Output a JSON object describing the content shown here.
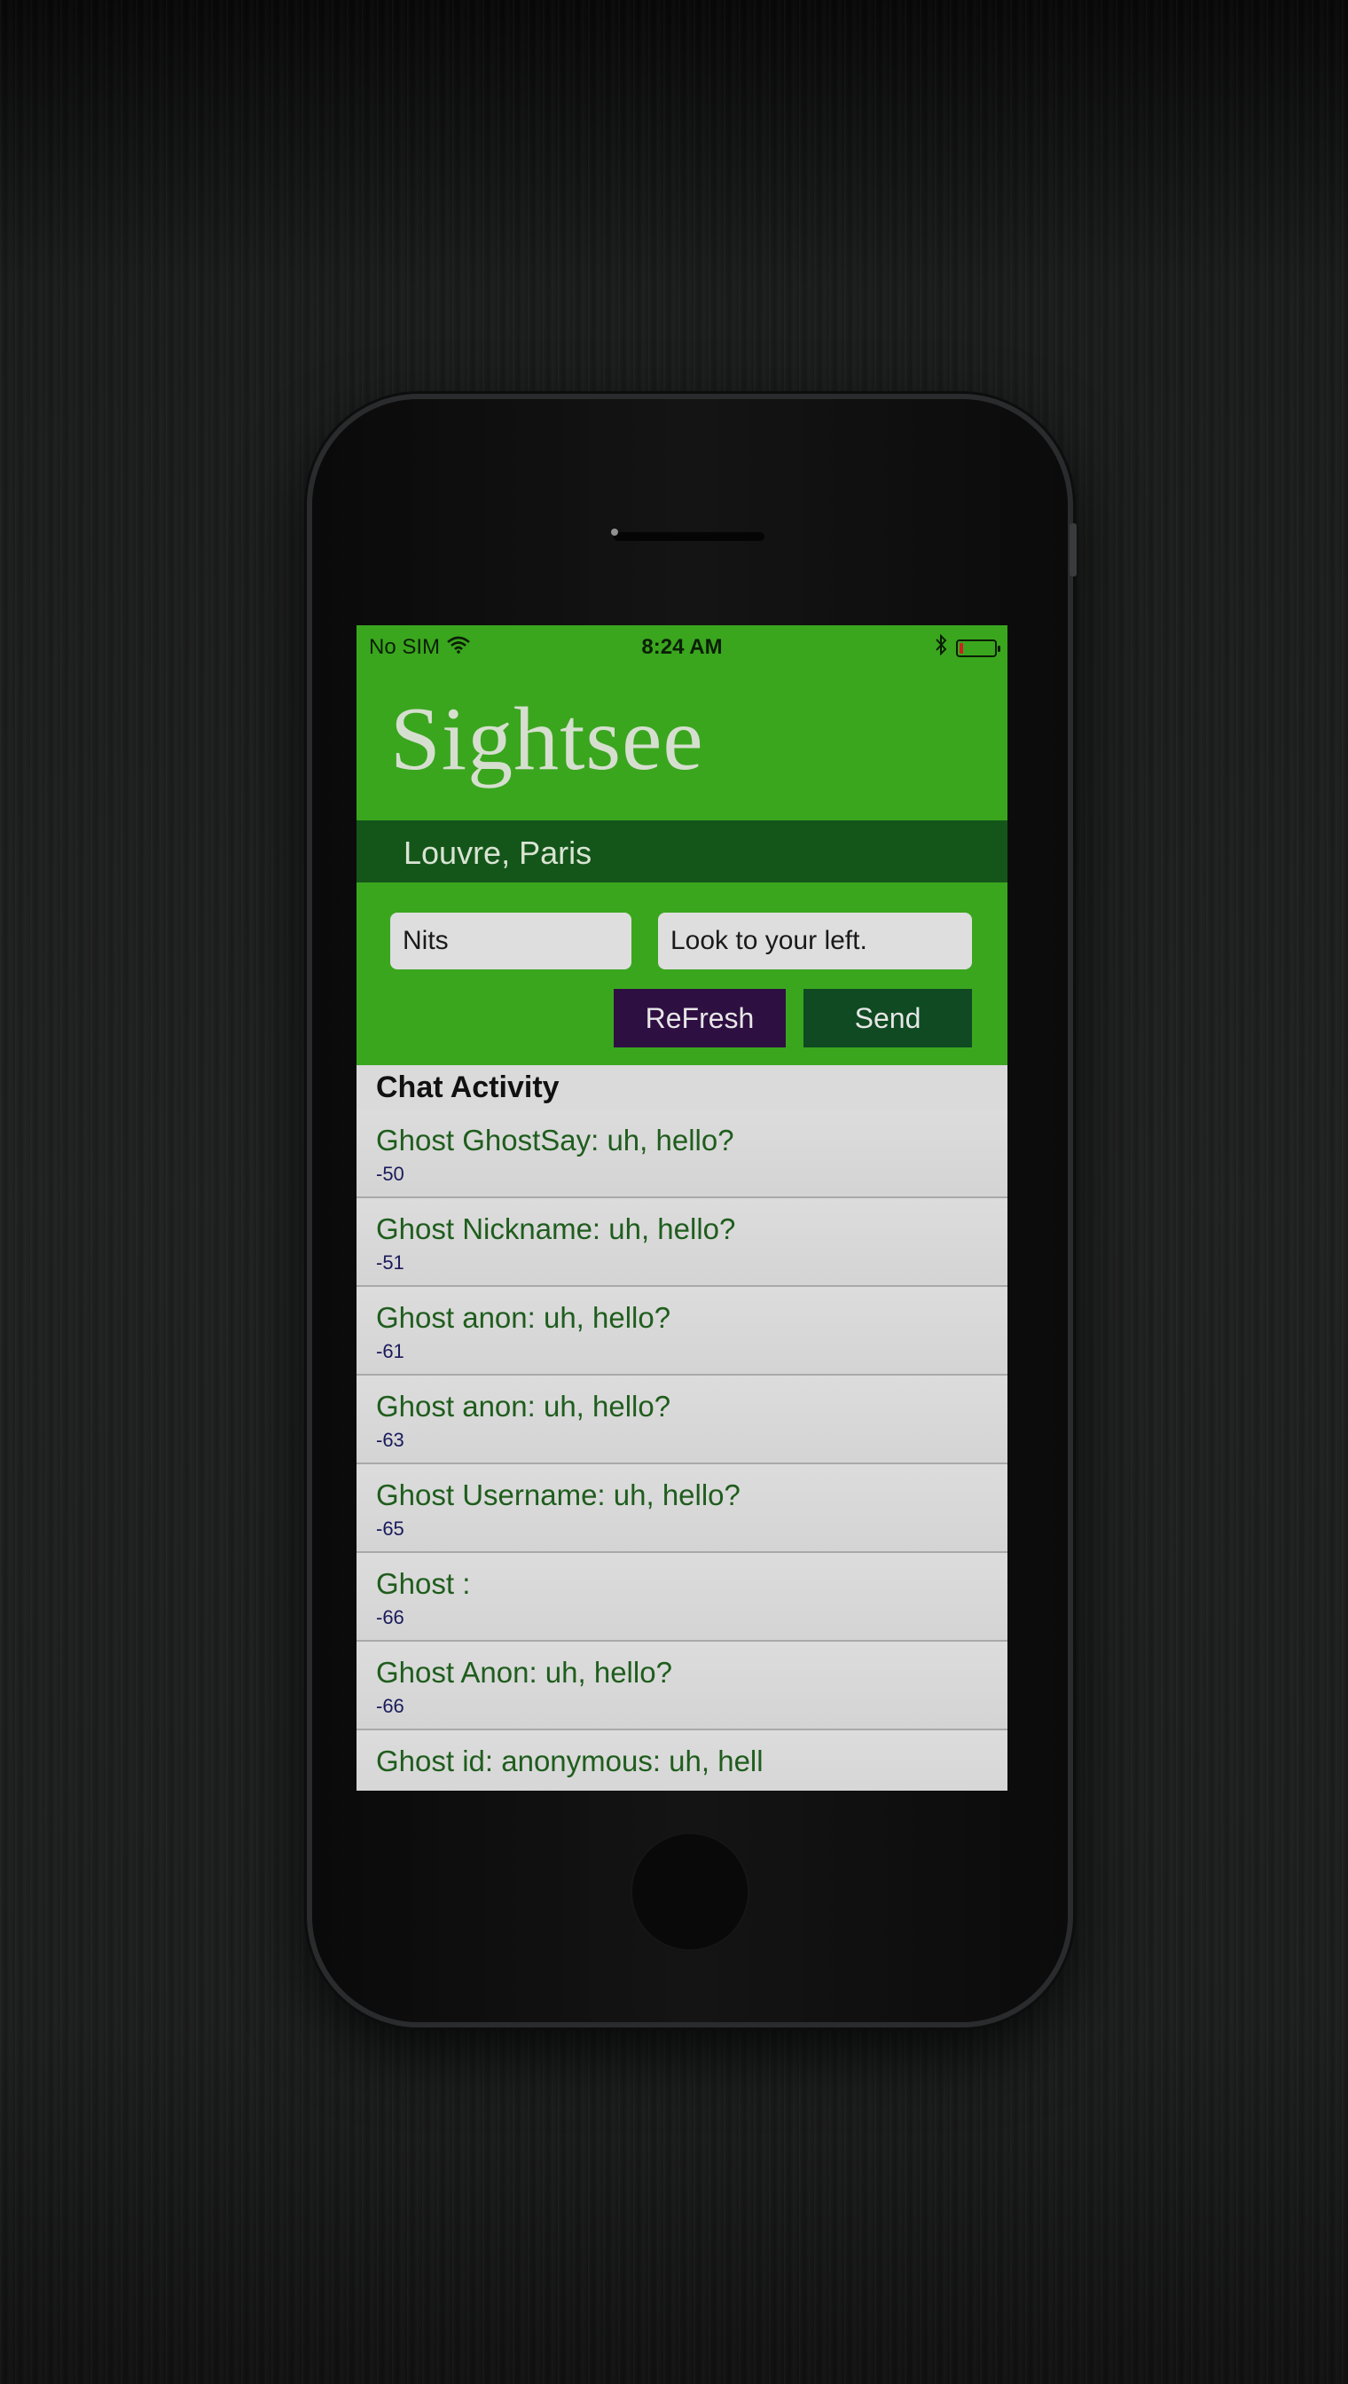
{
  "status_bar": {
    "carrier": "No SIM",
    "time": "8:24 AM",
    "battery_level": 0.1
  },
  "header": {
    "app_title": "Sightsee",
    "location": "Louvre, Paris"
  },
  "form": {
    "nickname_value": "Nits",
    "message_value": "Look to your left.",
    "refresh_label": "ReFresh",
    "send_label": "Send"
  },
  "chat": {
    "heading": "Chat Activity",
    "items": [
      {
        "message": "Ghost GhostSay: uh, hello?",
        "score": "-50"
      },
      {
        "message": "Ghost Nickname: uh, hello?",
        "score": "-51"
      },
      {
        "message": "Ghost anon: uh, hello?",
        "score": "-61"
      },
      {
        "message": "Ghost anon: uh, hello?",
        "score": "-63"
      },
      {
        "message": "Ghost Username: uh, hello?",
        "score": "-65"
      },
      {
        "message": "Ghost :",
        "score": "-66"
      },
      {
        "message": "Ghost Anon: uh, hello?",
        "score": "-66"
      },
      {
        "message": "Ghost id: anonymous: uh, hell",
        "score": ""
      }
    ]
  },
  "colors": {
    "header_green": "#3aa61e",
    "location_bar": "#14561a",
    "refresh_button": "#2e0f42",
    "send_button": "#0f4a22",
    "chat_text": "#1f5d1d"
  },
  "icons": [
    "wifi-icon",
    "bluetooth-icon",
    "battery-icon"
  ]
}
